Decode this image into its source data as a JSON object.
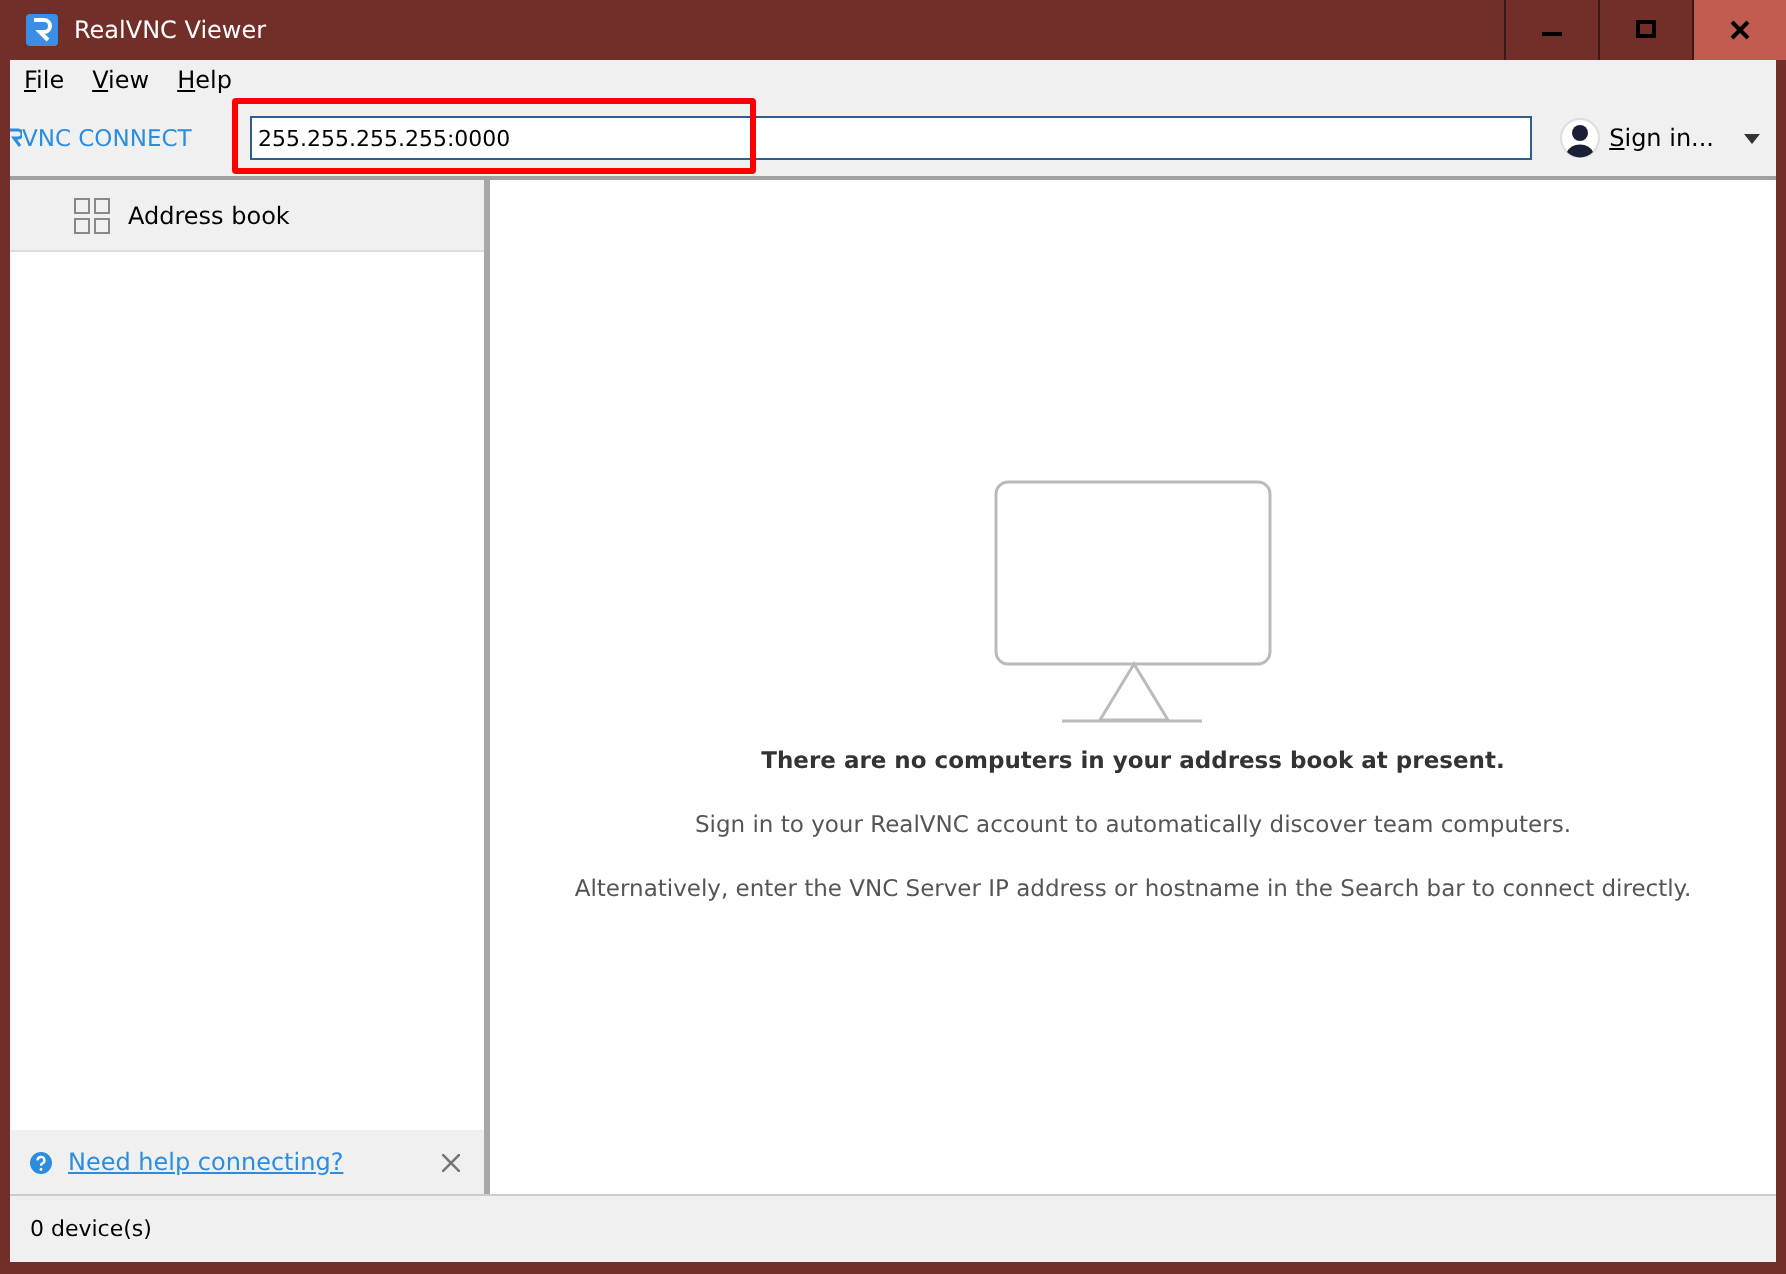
{
  "window": {
    "title": "RealVNC Viewer"
  },
  "menu": [
    "File",
    "View",
    "Help"
  ],
  "toolbar": {
    "logo": "VNC CONNECT",
    "search": {
      "value": "255.255.255.255:0000",
      "highlighted": true
    },
    "account": "Sign in..."
  },
  "sidebar": {
    "items": [
      {
        "label": "Address book",
        "selected": true
      }
    ],
    "help_link": "Need help connecting?"
  },
  "empty_state": {
    "heading": "There are no computers in your address book at present.",
    "lines": [
      "Sign in to your RealVNC account to automatically discover team computers.",
      "Alternatively, enter the VNC Server IP address or hostname in the Search bar to connect directly."
    ]
  },
  "status_bar": "0 device(s)"
}
